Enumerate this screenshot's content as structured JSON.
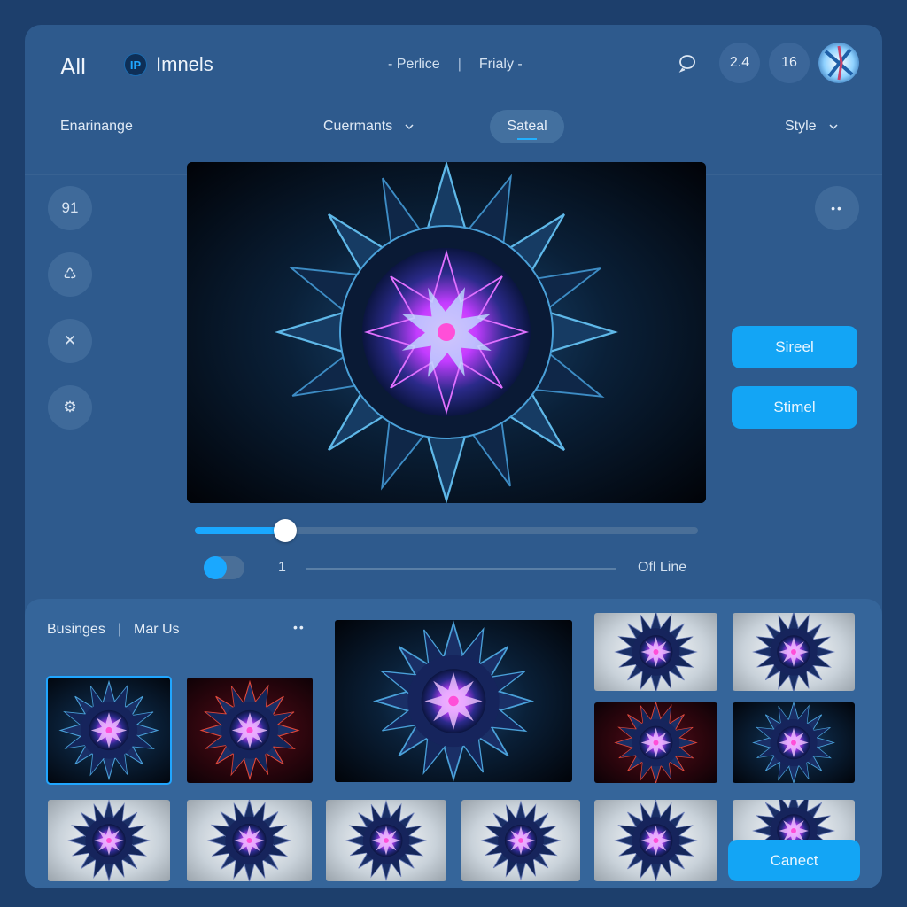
{
  "header": {
    "app_title": "All",
    "brand_logo_text": "IP",
    "brand_name": "Imnels",
    "center_nav": [
      "- Perlice",
      "Frialy -"
    ],
    "center_separator": "|",
    "counts": [
      "2.4",
      "16"
    ]
  },
  "subnav": {
    "left_label": "Enarinange",
    "dropdown_label": "Cuermants",
    "active_tab": "Sateal",
    "style_label": "Style"
  },
  "tools": {
    "icons": [
      "quote-icon",
      "brain-icon",
      "scissors-icon",
      "gear-icon"
    ],
    "glyphs": [
      "91",
      "♺",
      "✕",
      "⚙"
    ],
    "more_glyph": "••"
  },
  "actions": {
    "primary_label": "Sireel",
    "secondary_label": "Stimel",
    "cancel_label": "Canect"
  },
  "playback": {
    "progress": 0.18,
    "toggle_on": true,
    "frame_value": "1",
    "line_label": "Ofl Line"
  },
  "gallery": {
    "tab_1": "Businges",
    "tab_2": "Mar Us",
    "separator": "|",
    "more_glyph": "••",
    "thumbnails": [
      {
        "variant": "blue",
        "selected": true
      },
      {
        "variant": "red"
      },
      {
        "variant": "dark-large"
      },
      {
        "variant": "silver"
      },
      {
        "variant": "silver"
      },
      {
        "variant": "red"
      },
      {
        "variant": "blue"
      },
      {
        "variant": "silver"
      },
      {
        "variant": "silver"
      },
      {
        "variant": "silver"
      },
      {
        "variant": "silver"
      },
      {
        "variant": "silver"
      },
      {
        "variant": "silver"
      }
    ]
  },
  "colors": {
    "background": "#1d3f6c",
    "panel": "#2e5a8d",
    "accent": "#13a5f5",
    "magenta": "#d23cff"
  }
}
